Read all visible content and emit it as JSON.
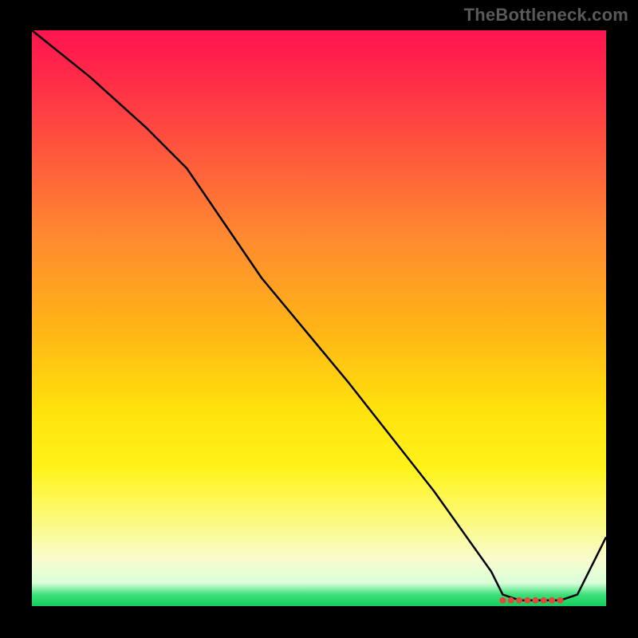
{
  "watermark": "TheBottleneck.com",
  "chart_data": {
    "type": "line",
    "title": "",
    "xlabel": "",
    "ylabel": "",
    "xlim": [
      0,
      100
    ],
    "ylim": [
      0,
      100
    ],
    "x": [
      0,
      10,
      20,
      27,
      40,
      55,
      70,
      80,
      82,
      85,
      88,
      90,
      92,
      95,
      100
    ],
    "values": [
      100,
      92,
      83,
      76,
      57,
      39,
      20,
      6,
      2,
      1,
      1,
      1,
      1,
      2,
      12
    ],
    "flat_region": {
      "x_start": 82,
      "x_end": 92,
      "marker_count": 8
    },
    "colors": {
      "line": "#000000",
      "marker": "#e04a3a"
    }
  }
}
